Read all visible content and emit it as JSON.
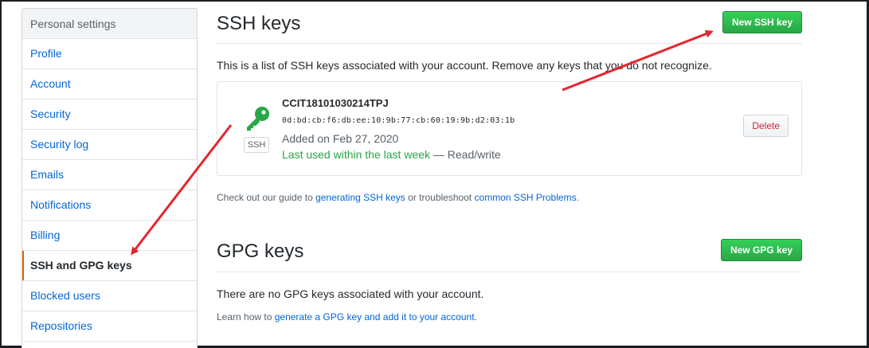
{
  "sidebar": {
    "header": "Personal settings",
    "items": [
      {
        "label": "Profile"
      },
      {
        "label": "Account"
      },
      {
        "label": "Security"
      },
      {
        "label": "Security log"
      },
      {
        "label": "Emails"
      },
      {
        "label": "Notifications"
      },
      {
        "label": "Billing"
      },
      {
        "label": "SSH and GPG keys",
        "selected": true
      },
      {
        "label": "Blocked users"
      },
      {
        "label": "Repositories"
      }
    ]
  },
  "ssh": {
    "title": "SSH keys",
    "new_button": "New SSH key",
    "description": "This is a list of SSH keys associated with your account. Remove any keys that you do not recognize.",
    "key": {
      "badge": "SSH",
      "title": "CCIT18101030214TPJ",
      "fingerprint": "0d:bd:cb:f6:db:ee:10:9b:77:cb:60:19:9b:d2:03:1b",
      "added": "Added on Feb 27, 2020",
      "last_used": "Last used within the last week",
      "access": " — Read/write",
      "delete_button": "Delete",
      "icon": "key-icon",
      "icon_color": "#28a745"
    },
    "guide": {
      "prefix": "Check out our guide to ",
      "link1": "generating SSH keys",
      "middle": " or troubleshoot ",
      "link2": "common SSH Problems",
      "suffix": "."
    }
  },
  "gpg": {
    "title": "GPG keys",
    "new_button": "New GPG key",
    "empty": "There are no GPG keys associated with your account.",
    "learn": {
      "prefix": "Learn how to ",
      "link": "generate a GPG key and add it to your account",
      "suffix": "."
    }
  },
  "colors": {
    "link": "#0366d6",
    "primary_button": "#28a745",
    "danger": "#cb2431",
    "selected_accent": "#e36209",
    "annotation_arrow": "#e3262e"
  }
}
